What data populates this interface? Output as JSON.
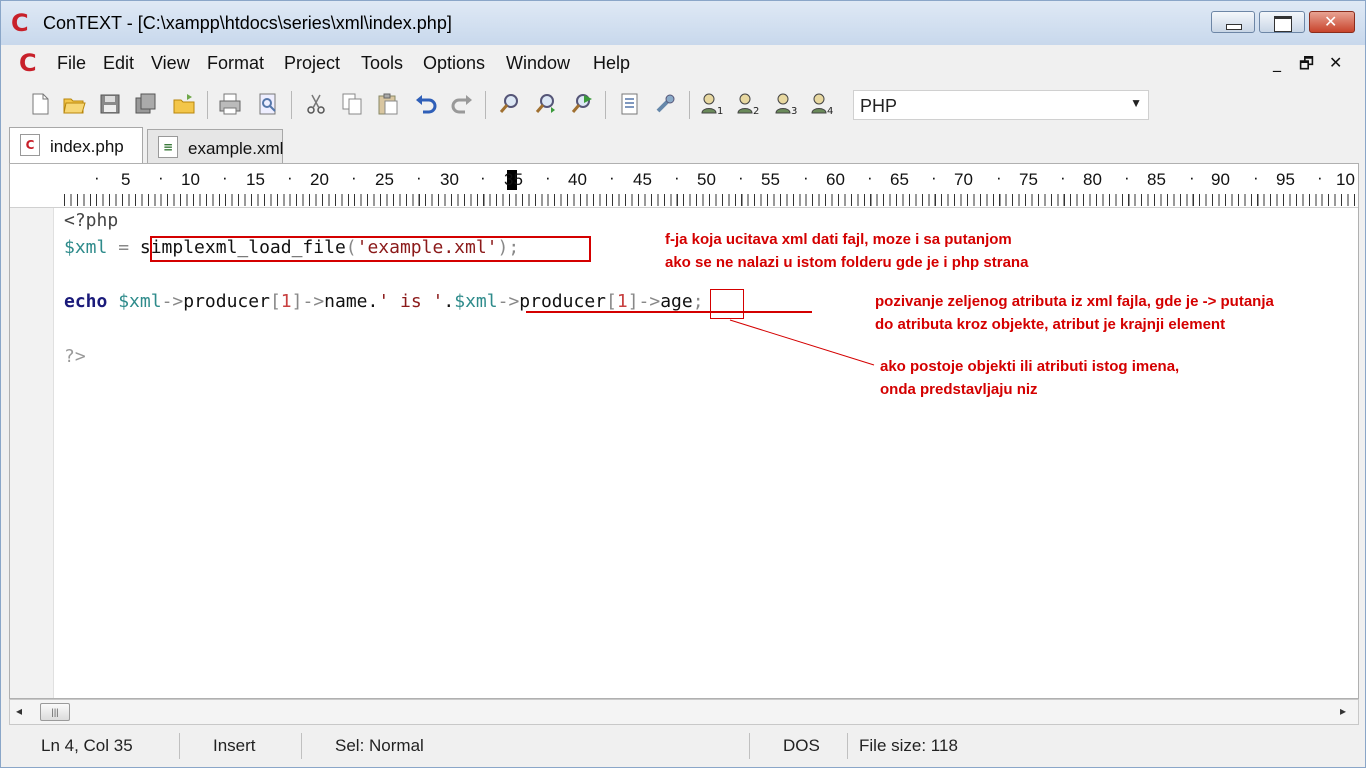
{
  "window": {
    "title": "ConTEXT - [C:\\xampp\\htdocs\\series\\xml\\index.php]",
    "app_icon_letter": "C"
  },
  "menu": [
    "File",
    "Edit",
    "View",
    "Format",
    "Project",
    "Tools",
    "Options",
    "Window",
    "Help"
  ],
  "mdi_controls": [
    "_",
    "🗗",
    "✕"
  ],
  "toolbar": {
    "icons": [
      "new-file-icon",
      "open-file-icon",
      "save-icon",
      "save-all-icon",
      "open-folder-icon",
      "print-icon",
      "print-preview-icon",
      "cut-icon",
      "copy-icon",
      "paste-icon",
      "undo-icon",
      "redo-icon",
      "find-icon",
      "find-next-icon",
      "replace-icon",
      "file-info-icon",
      "wrench-icon",
      "user-1-icon",
      "user-2-icon",
      "user-3-icon",
      "user-4-icon"
    ],
    "language": "PHP"
  },
  "tabs": [
    {
      "label": "index.php",
      "active": true
    },
    {
      "label": "example.xml",
      "active": false
    }
  ],
  "ruler": {
    "numbers": [
      "5",
      "10",
      "15",
      "20",
      "25",
      "30",
      "35",
      "40",
      "45",
      "50",
      "55",
      "60",
      "65",
      "70",
      "75",
      "80",
      "85",
      "90",
      "95",
      "10"
    ],
    "cursor_column": 35
  },
  "code": {
    "line1": "<?php",
    "line2": {
      "var": "$xml",
      "eq": " = ",
      "fn": "simplexml_load_file",
      "open": "(",
      "str": "'example.xml'",
      "close": ")",
      "end": ";"
    },
    "line4": {
      "kw": "echo",
      "sp": " ",
      "var1": "$xml",
      "arrow1": "->",
      "prop1": "producer",
      "lb1": "[",
      "idx1": "1",
      "rb1": "]",
      "arrow2": "->",
      "prop2": "name",
      "dot1": ".",
      "str1": "' is '",
      "dot2": ".",
      "var2": "$xml",
      "arrow3": "->",
      "prop3": "producer",
      "lb2": "[",
      "idx2": "1",
      "rb2": "]",
      "arrow4": "->",
      "prop4": "age",
      "end": ";"
    },
    "line6": "?>"
  },
  "annotations": {
    "note1": "f-ja koja ucitava xml dati fajl, moze i sa putanjom\nako se ne nalazi u istom folderu gde je i php strana",
    "note2": "pozivanje zeljenog atributa iz xml fajla, gde je -> putanja\ndo atributa kroz objekte, atribut je krajnji element",
    "note3": "ako postoje objekti ili atributi istog imena,\nonda predstavljaju niz",
    "color": "#d40000"
  },
  "scrollbar": {
    "left": "◂",
    "thumb": "|||",
    "right": "▸"
  },
  "status": {
    "position": "Ln 4, Col 35",
    "mode": "Insert",
    "selection": "Sel: Normal",
    "line_ending": "DOS",
    "file_size": "File size: 118"
  }
}
